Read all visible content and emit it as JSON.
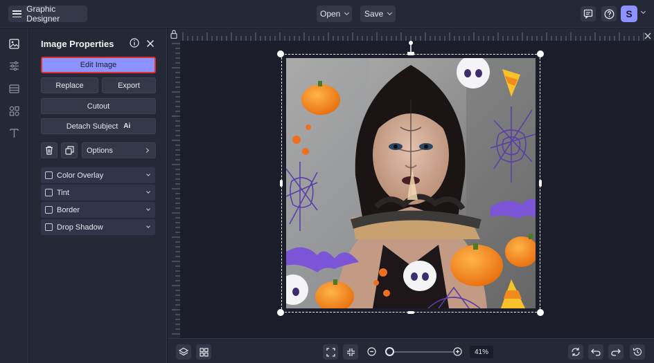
{
  "topbar": {
    "app_title": "Graphic Designer",
    "open_label": "Open",
    "save_label": "Save",
    "avatar_initial": "S"
  },
  "panel": {
    "title": "Image Properties",
    "edit_image": "Edit Image",
    "replace": "Replace",
    "export": "Export",
    "cutout": "Cutout",
    "detach_subject": "Detach Subject",
    "detach_badge": "Ai",
    "options": "Options",
    "accordions": [
      {
        "label": "Color Overlay",
        "checked": false
      },
      {
        "label": "Tint",
        "checked": false
      },
      {
        "label": "Border",
        "checked": false
      },
      {
        "label": "Drop Shadow",
        "checked": false
      }
    ]
  },
  "bottombar": {
    "zoom_level": "41%",
    "zoom_fraction": 0.41
  },
  "colors": {
    "accent": "#8c92ff",
    "highlight_border": "#e0302a",
    "panel_bg": "#252837",
    "canvas_bg": "#1b1d2a"
  },
  "icons": {
    "rail": [
      "image-icon",
      "sliders-icon",
      "layout-icon",
      "elements-icon",
      "text-icon"
    ],
    "topbar_right": [
      "comment-icon",
      "help-icon"
    ],
    "bottombar": [
      "layers-icon",
      "grid-icon",
      "fit-icon",
      "shrink-icon",
      "zoom-out-icon",
      "zoom-in-icon",
      "rotate-icon",
      "undo-icon",
      "redo-icon",
      "history-icon"
    ]
  }
}
